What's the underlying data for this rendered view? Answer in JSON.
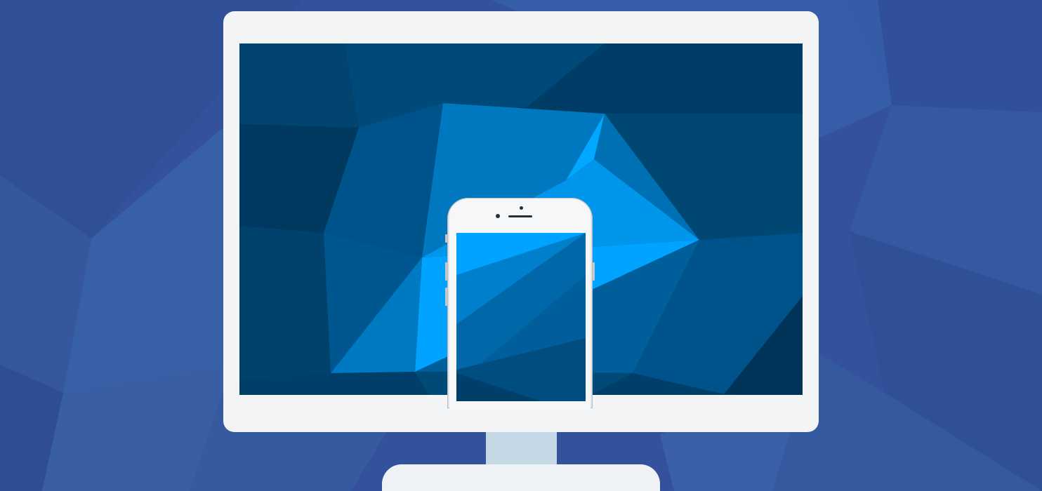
{
  "scene": {
    "description_color_scheme": "",
    "colors": {
      "background_base": "#33529b",
      "monitor_bezel": "#f2f4f6",
      "monitor_stand": "#c5d8e6",
      "screen_dark": "#003d66",
      "screen_mid": "#0062a0",
      "screen_bright": "#00a3ff",
      "phone_body": "#f4f5f6"
    },
    "icons": [
      "monitor-icon",
      "smartphone-icon"
    ]
  }
}
